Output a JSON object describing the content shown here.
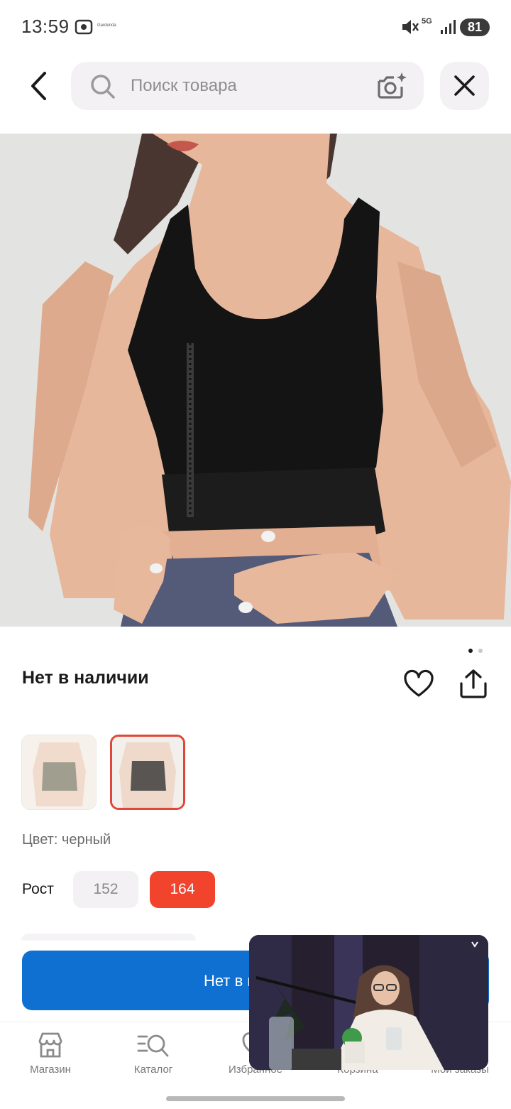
{
  "status_bar": {
    "time": "13:59",
    "tiny_text": "Gardenda",
    "network": "5G",
    "battery": "81"
  },
  "header": {
    "search_placeholder": "Поиск товара"
  },
  "product": {
    "availability": "Нет в наличии",
    "color_label": "Цвет: черный",
    "height_label": "Рост",
    "sizes": [
      "152",
      "164"
    ],
    "selected_size": "164",
    "image_count": 2,
    "current_image": 1
  },
  "buy_button": {
    "label": "Нет в н"
  },
  "bottom_nav": {
    "items": [
      {
        "label": "Магазин",
        "icon": "store-icon"
      },
      {
        "label": "Каталог",
        "icon": "catalog-search-icon"
      },
      {
        "label": "Избранное",
        "icon": "heart-icon"
      },
      {
        "label": "Корзина",
        "icon": "cart-icon"
      },
      {
        "label": "Мои заказы",
        "icon": "orders-icon"
      }
    ]
  },
  "colors": {
    "accent_red": "#f2432c",
    "button_blue": "#0f70d2",
    "chip_bg": "#f3f1f4"
  }
}
